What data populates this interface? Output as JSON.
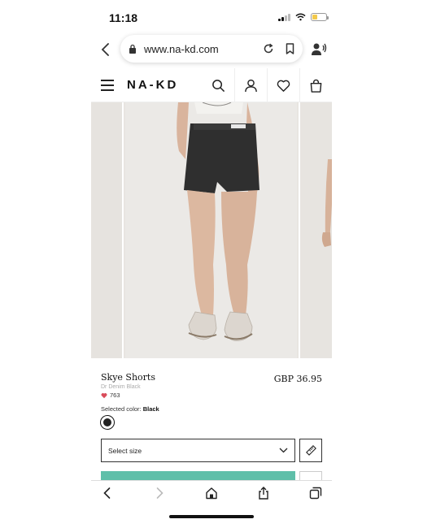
{
  "status_bar": {
    "time": "11:18"
  },
  "browser": {
    "url": "www.na-kd.com",
    "icons": [
      "back-chevron-icon",
      "lock-icon",
      "reload-icon",
      "bookmark-icon",
      "voice-icon"
    ]
  },
  "site_header": {
    "logo": "NA-KD",
    "icons": [
      "menu-icon",
      "search-icon",
      "account-icon",
      "heart-icon",
      "bag-icon"
    ]
  },
  "product": {
    "name": "Skye Shorts",
    "subtitle": "Dr Denim Black",
    "likes": "763",
    "price": "GBP 36.95",
    "selected_color_label": "Selected color:",
    "selected_color_value": "Black",
    "color_swatch": "#222222",
    "size_placeholder": "Select size"
  },
  "colors": {
    "add_to_bag": "#5fbfa9"
  },
  "toolbar": {
    "icons": [
      "back-icon",
      "forward-icon",
      "home-icon",
      "share-icon",
      "tabs-icon"
    ]
  }
}
